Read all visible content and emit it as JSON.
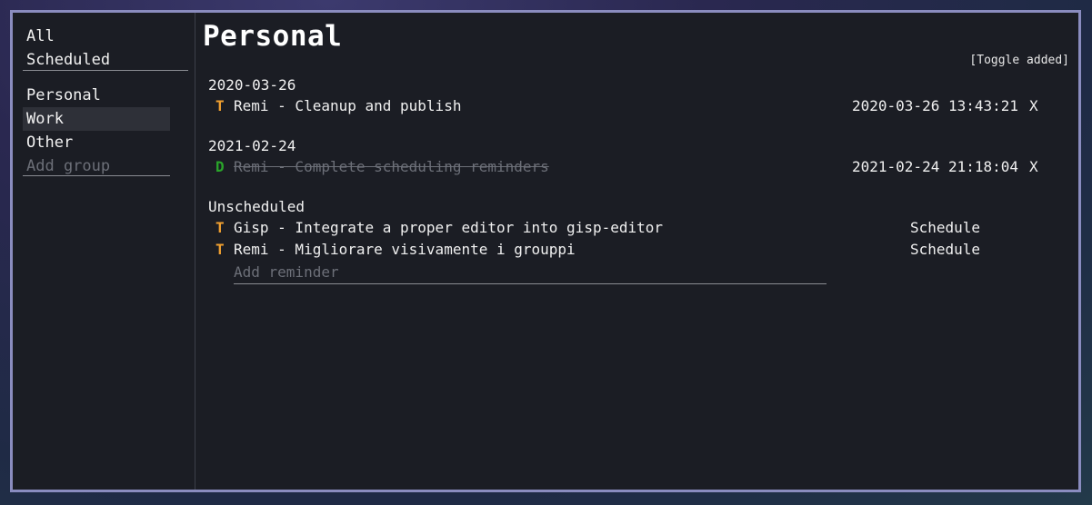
{
  "sidebar": {
    "filters": [
      "All",
      "Scheduled"
    ],
    "groups": [
      "Personal",
      "Work",
      "Other"
    ],
    "selected_group": "Work",
    "add_group_placeholder": "Add group"
  },
  "main": {
    "title": "Personal",
    "toggle_label": "[Toggle added]",
    "sections": [
      {
        "header": "2020-03-26",
        "items": [
          {
            "status": "T",
            "text": "Remi - Cleanup and publish",
            "timestamp": "2020-03-26 13:43:21",
            "action": "X",
            "done": false
          }
        ]
      },
      {
        "header": "2021-02-24",
        "items": [
          {
            "status": "D",
            "text": "Remi - Complete scheduling reminders",
            "timestamp": "2021-02-24 21:18:04",
            "action": "X",
            "done": true
          }
        ]
      },
      {
        "header": "Unscheduled",
        "items": [
          {
            "status": "T",
            "text": "Gisp - Integrate a proper editor into gisp-editor",
            "action": "Schedule"
          },
          {
            "status": "T",
            "text": "Remi - Migliorare visivamente i grouppi",
            "action": "Schedule"
          }
        ]
      }
    ],
    "add_reminder_placeholder": "Add reminder"
  },
  "colors": {
    "window_border": "#8a8cbf",
    "panel_bg": "#1b1d24",
    "todo": "#f0a030",
    "done": "#2aa52a",
    "placeholder": "#6c6f78"
  }
}
